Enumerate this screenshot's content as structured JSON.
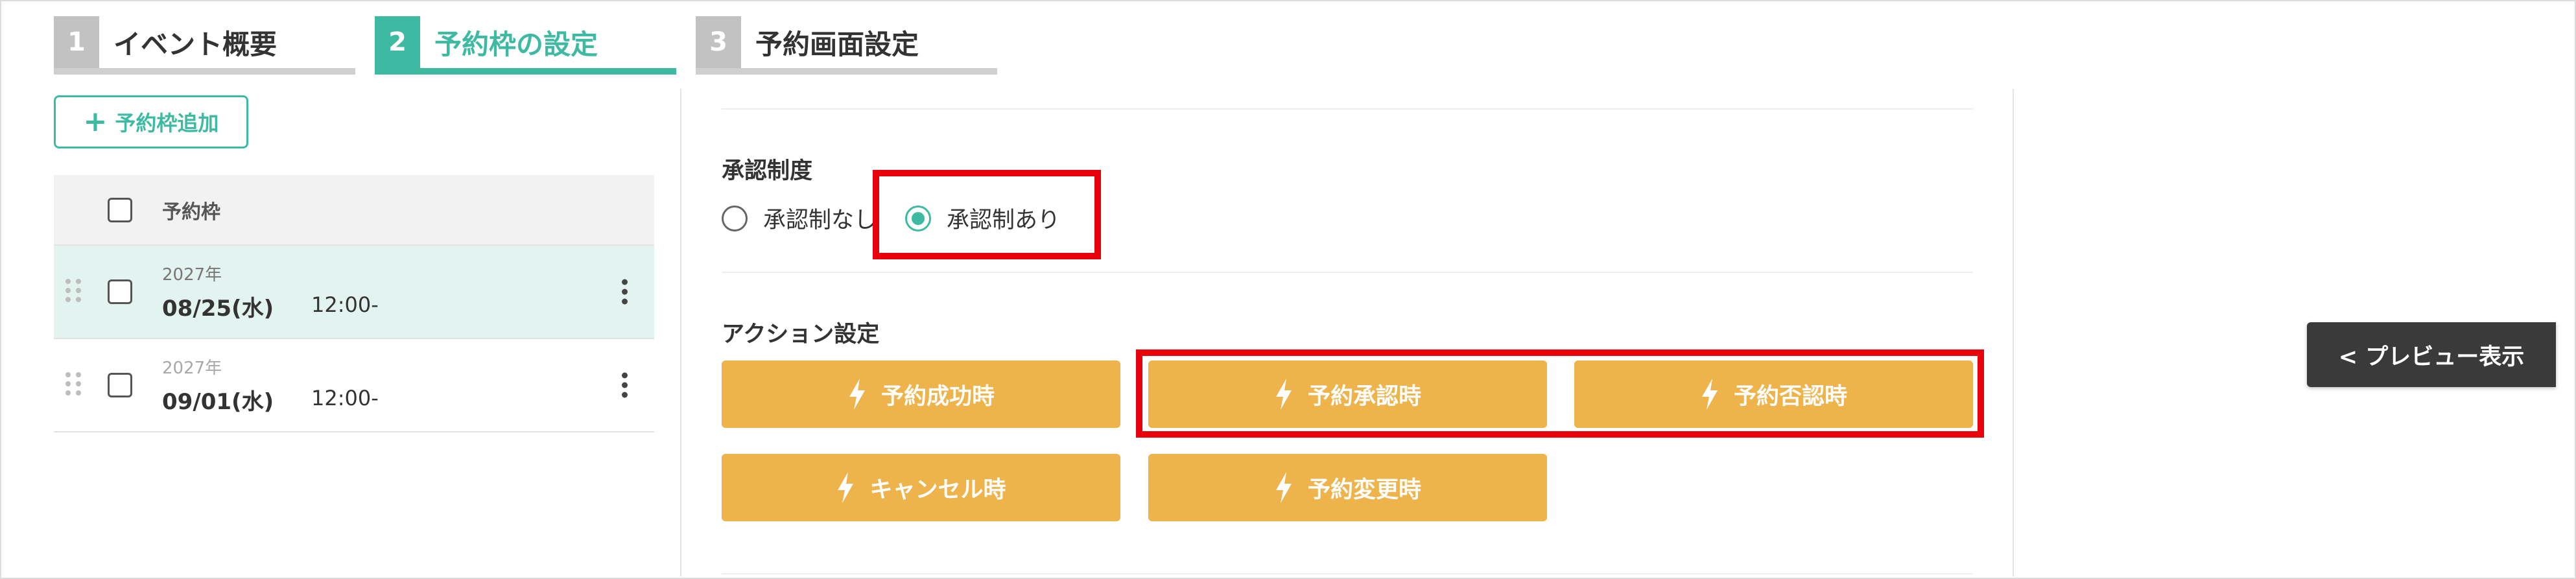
{
  "steps": [
    {
      "num": "1",
      "label": "イベント概要"
    },
    {
      "num": "2",
      "label": "予約枠の設定"
    },
    {
      "num": "3",
      "label": "予約画面設定"
    }
  ],
  "sidebar": {
    "add_label": "予約枠追加",
    "column_header": "予約枠",
    "rows": [
      {
        "year": "2027年",
        "date": "08/25(水)",
        "time": "12:00-"
      },
      {
        "year": "2027年",
        "date": "09/01(水)",
        "time": "12:00-"
      }
    ]
  },
  "approval": {
    "title": "承認制度",
    "options": [
      "承認制なし",
      "承認制あり"
    ],
    "selected": "承認制あり"
  },
  "actions": {
    "title": "アクション設定",
    "buttons": [
      "予約成功時",
      "予約承認時",
      "予約否認時",
      "キャンセル時",
      "予約変更時"
    ]
  },
  "preview": {
    "label": "< プレビュー表示"
  },
  "colors": {
    "accent": "#3dbaa1",
    "action": "#efb34b",
    "highlight": "#e8000b",
    "preview": "#3a3a3a"
  },
  "icons": {
    "add": "plus-icon",
    "drag": "drag-handle-icon",
    "menu": "kebab-menu-icon",
    "action": "lightning-bolt-icon"
  }
}
